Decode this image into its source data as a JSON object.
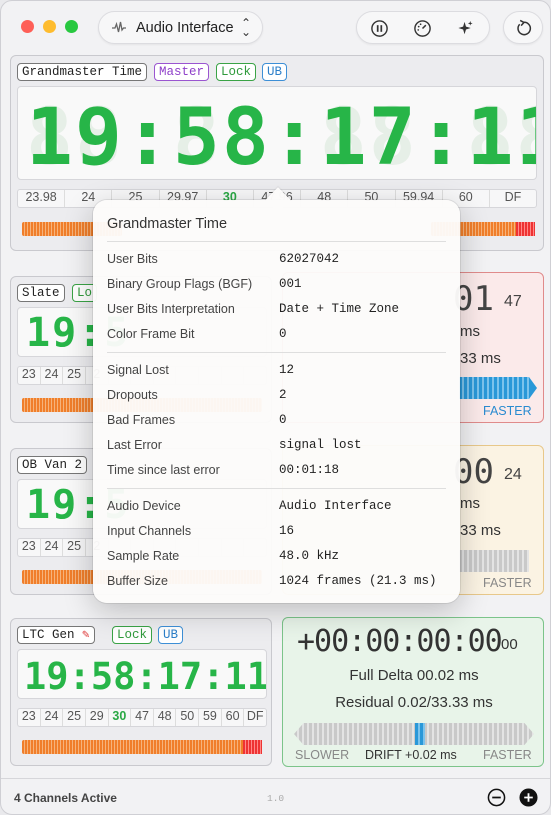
{
  "toolbar": {
    "device_label": "Audio Interface",
    "wave_icon": "waveform-icon",
    "tools": [
      "pause-icon",
      "speedometer-icon",
      "sparkles-icon"
    ],
    "reload_icon": "reload-icon"
  },
  "main_panel": {
    "title": "Grandmaster Time",
    "tags": [
      "Master",
      "Lock",
      "UB"
    ],
    "timecode": "19:58:17:11",
    "fps": [
      "23.98",
      "24",
      "25",
      "29.97",
      "30",
      "47.96",
      "48",
      "50",
      "59.94",
      "60",
      "DF"
    ],
    "fps_active": "30"
  },
  "channels": [
    {
      "title": "Slate",
      "tags": [
        "Lo"
      ],
      "timecode": "19:5",
      "fps": [
        "23",
        "24",
        "25",
        "2"
      ]
    },
    {
      "title": "OB Van 2",
      "tags": [],
      "timecode": "19:5",
      "fps": [
        "23",
        "24",
        "25",
        "2"
      ]
    },
    {
      "title": "LTC Gen",
      "tags": [
        "Lock",
        "UB"
      ],
      "timecode": "19:58:17:11",
      "fps": [
        "23",
        "24",
        "25",
        "29",
        "30",
        "47",
        "48",
        "50",
        "59",
        "60",
        "DF"
      ],
      "fps_active": "30"
    }
  ],
  "right_panels": [
    {
      "frames_main": "01",
      "frames_sub": "47",
      "line1": "ms",
      "line2": "33 ms",
      "drift_label": "FASTER"
    },
    {
      "frames_main": "00",
      "frames_sub": "24",
      "line1": "ms",
      "line2": "33 ms",
      "drift_label": "FASTER"
    },
    {
      "timecode": "+00:00:00:00",
      "frames_sub": "00",
      "full_delta_label": "Full Delta",
      "full_delta_value": "00.02 ms",
      "residual_label": "Residual",
      "residual_value": "0.02/33.33 ms",
      "slower": "SLOWER",
      "drift": "DRIFT +0.02 ms",
      "faster": "FASTER"
    }
  ],
  "popover": {
    "title": "Grandmaster Time",
    "groups": [
      [
        {
          "k": "User Bits",
          "v": "62027042"
        },
        {
          "k": "Binary Group Flags (BGF)",
          "v": "001"
        },
        {
          "k": "User Bits Interpretation",
          "v": "Date + Time Zone"
        },
        {
          "k": "Color Frame Bit",
          "v": "0"
        }
      ],
      [
        {
          "k": "Signal Lost",
          "v": "12"
        },
        {
          "k": "Dropouts",
          "v": "2"
        },
        {
          "k": "Bad Frames",
          "v": "0"
        },
        {
          "k": "Last Error",
          "v": "signal lost"
        },
        {
          "k": "Time since last error",
          "v": "00:01:18"
        }
      ],
      [
        {
          "k": "Audio Device",
          "v": "Audio Interface"
        },
        {
          "k": "Input Channels",
          "v": "16"
        },
        {
          "k": "Sample Rate",
          "v": "48.0 kHz"
        },
        {
          "k": "Buffer Size",
          "v": "1024 frames (21.3 ms)"
        }
      ]
    ]
  },
  "bottom": {
    "status": "4 Channels Active",
    "version": "1.0"
  },
  "colors": {
    "digit": "#27b548",
    "accent_master": "#8e3fc9",
    "accent_lock": "#2f9a3b",
    "accent_ub": "#2c7fc9"
  }
}
